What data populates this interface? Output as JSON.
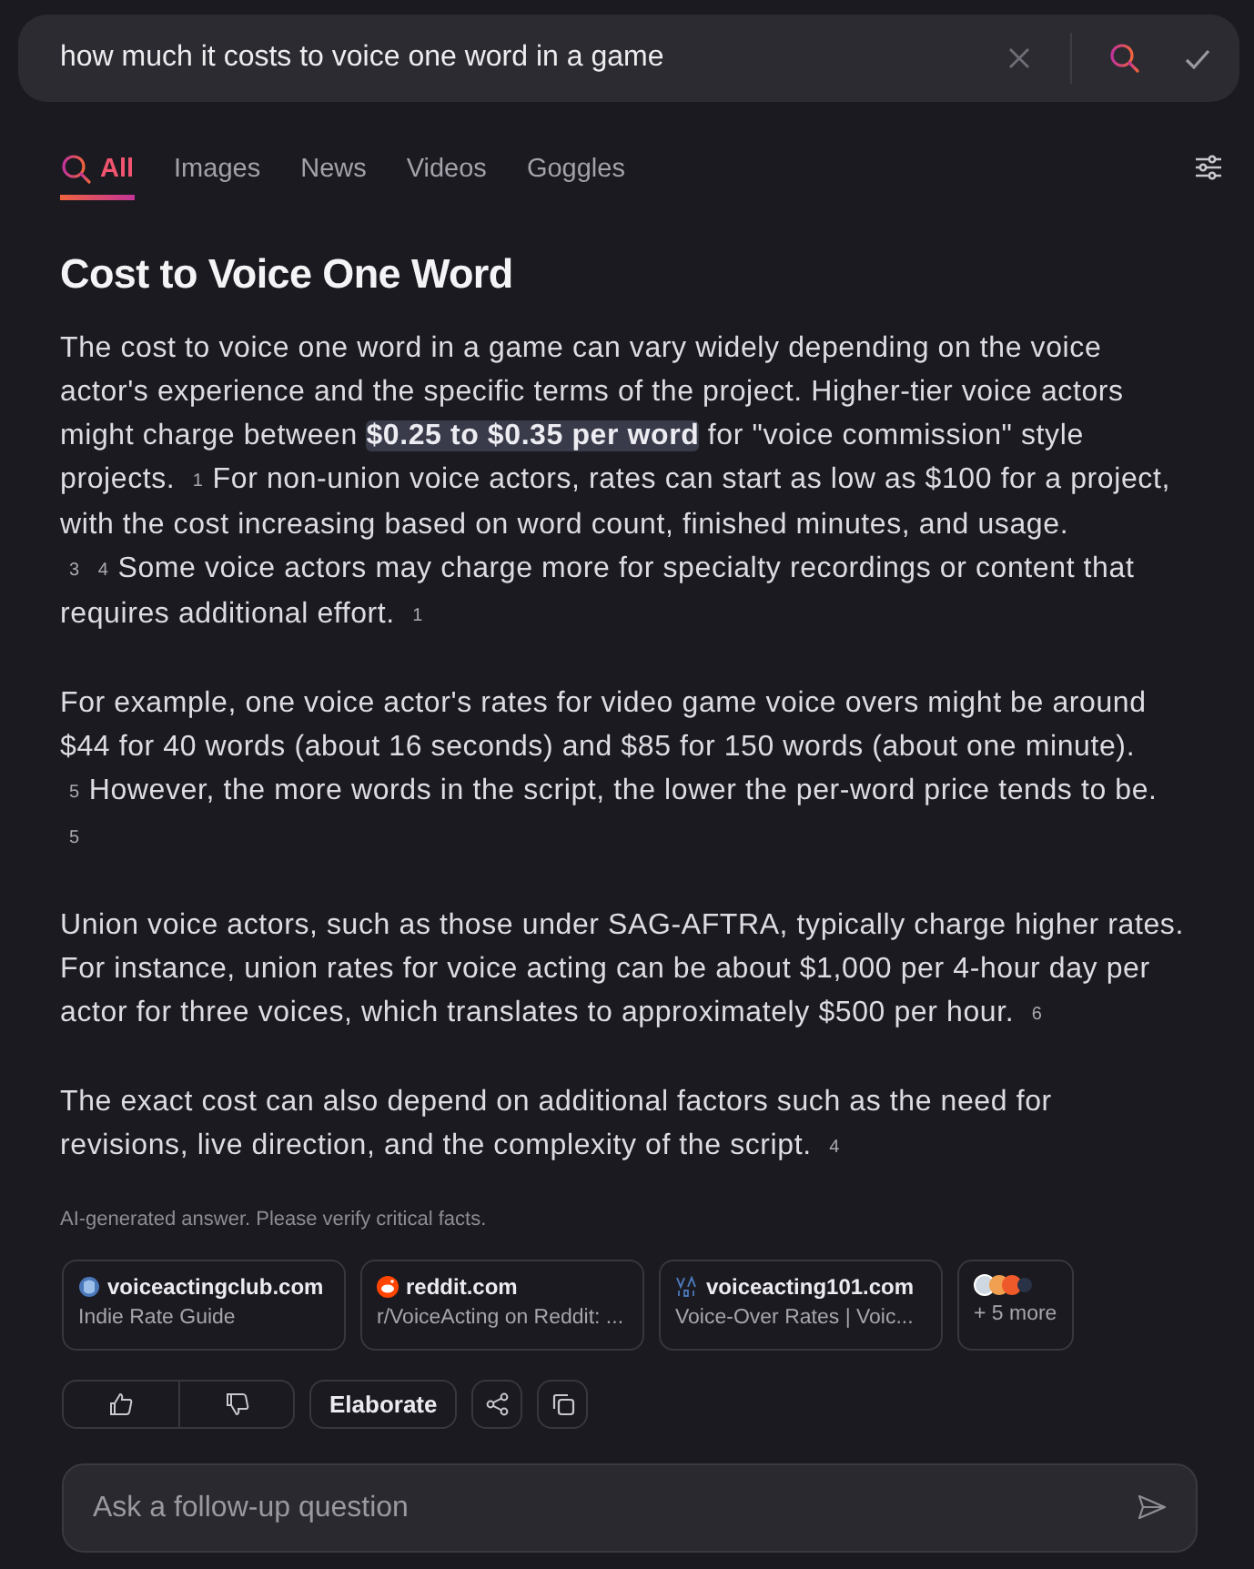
{
  "search": {
    "value": "how much it costs to voice one word in a game"
  },
  "tabs": [
    {
      "label": "All",
      "selected": true,
      "icon": true
    },
    {
      "label": "Images",
      "selected": false
    },
    {
      "label": "News",
      "selected": false
    },
    {
      "label": "Videos",
      "selected": false
    },
    {
      "label": "Goggles",
      "selected": false
    }
  ],
  "answer": {
    "title": "Cost to Voice One Word",
    "paragraphs": [
      [
        {
          "kind": "text",
          "text": "The cost to voice one word in a game can vary widely depending on the voice actor's experience and the specific terms of the project. Higher-tier voice actors might charge between **$0.25 to $0.35 per word** for \"voice commission\" style projects."
        },
        {
          "kind": "cite",
          "text": "1"
        },
        {
          "kind": "text",
          "text": "For non-union voice actors, rates can start as low as $100 for a project, with the cost increasing based on word count, finished minutes, and usage."
        },
        {
          "kind": "cite",
          "text": "3"
        },
        {
          "kind": "cite",
          "text": "4"
        },
        {
          "kind": "text",
          "text": "Some voice actors may charge more for specialty recordings or content that requires additional effort."
        },
        {
          "kind": "cite",
          "text": "1"
        }
      ],
      [
        {
          "kind": "text",
          "text": "For example, one voice actor's rates for video game voice overs might be around $44 for 40 words (about 16 seconds) and $85 for 150 words (about one minute)."
        },
        {
          "kind": "cite",
          "text": "5"
        },
        {
          "kind": "text",
          "text": "However, the more words in the script, the lower the per-word price tends to be."
        },
        {
          "kind": "cite",
          "text": "5"
        }
      ],
      [
        {
          "kind": "text",
          "text": "Union voice actors, such as those under SAG-AFTRA, typically charge higher rates. For instance, union rates for voice acting can be about $1,000 per 4-hour day per actor for three voices, which translates to approximately $500 per hour."
        },
        {
          "kind": "cite",
          "text": "6"
        }
      ],
      [
        {
          "kind": "text",
          "text": "The exact cost can also depend on additional factors such as the need for revisions, live direction, and the complexity of the script."
        },
        {
          "kind": "cite",
          "text": "4"
        }
      ]
    ],
    "disclaimer": "AI-generated answer. Please verify critical facts."
  },
  "sources": [
    {
      "kind": "globe",
      "site": "voiceactingclub.com",
      "title": "Indie Rate Guide"
    },
    {
      "kind": "reddit",
      "site": "reddit.com",
      "title": "r/VoiceActing on Reddit: ..."
    },
    {
      "kind": "va",
      "site": "voiceacting101.com",
      "title": "Voice-Over Rates | Voic..."
    },
    {
      "kind": "more",
      "title": "+ 5 more"
    }
  ],
  "actions": {
    "elaborate": "Elaborate"
  },
  "followup": {
    "placeholder": "Ask a follow-up question"
  }
}
